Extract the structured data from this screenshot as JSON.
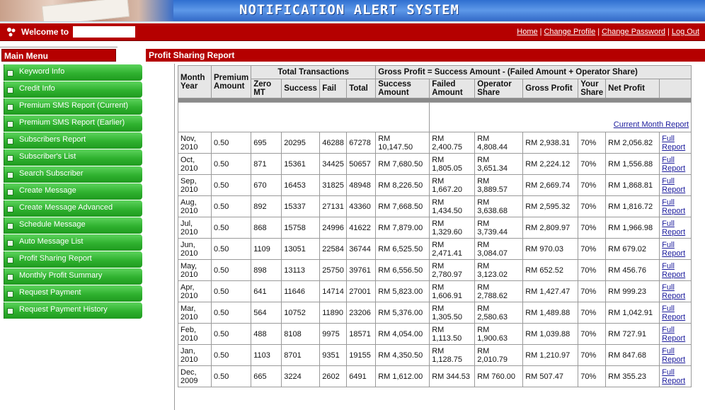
{
  "banner": {
    "title": "NOTIFICATION ALERT SYSTEM"
  },
  "welcome": {
    "text": "Welcome to"
  },
  "top_links": [
    "Home",
    "Change Profile",
    "Change Password",
    "Log Out"
  ],
  "menu": {
    "title": "Main Menu",
    "items": [
      "Keyword Info",
      "Credit Info",
      "Premium SMS Report (Current)",
      "Premium SMS Report (Earlier)",
      "Subscribers Report",
      "Subscriber's List",
      "Search Subscriber",
      "Create Message",
      "Create Message Advanced",
      "Schedule Message",
      "Auto Message List",
      "Profit Sharing Report",
      "Monthly Profit Summary",
      "Request Payment",
      "Request Payment History"
    ]
  },
  "report": {
    "title": "Profit Sharing Report",
    "headers": {
      "month_year": "Month Year",
      "premium_amount": "Premium Amount",
      "total_transactions": "Total Transactions",
      "gross_formula": "Gross Profit = Success Amount - (Failed Amount + Operator Share)",
      "zero_mt": "Zero MT",
      "success": "Success",
      "fail": "Fail",
      "total": "Total",
      "success_amount": "Success Amount",
      "failed_amount": "Failed Amount",
      "operator_share": "Operator Share",
      "gross_profit": "Gross Profit",
      "your_share": "Your Share",
      "net_profit": "Net Profit"
    },
    "current_month_link": "Current Month Report",
    "full_report_label": "Full Report",
    "rows": [
      {
        "month": "Nov, 2010",
        "premium": "0.50",
        "zero_mt": "695",
        "success": "20295",
        "fail": "46288",
        "total": "67278",
        "success_amount": "RM 10,147.50",
        "failed_amount": "RM 2,400.75",
        "operator_share": "RM 4,808.44",
        "gross_profit": "RM 2,938.31",
        "your_share": "70%",
        "net_profit": "RM 2,056.82"
      },
      {
        "month": "Oct, 2010",
        "premium": "0.50",
        "zero_mt": "871",
        "success": "15361",
        "fail": "34425",
        "total": "50657",
        "success_amount": "RM 7,680.50",
        "failed_amount": "RM 1,805.05",
        "operator_share": "RM 3,651.34",
        "gross_profit": "RM 2,224.12",
        "your_share": "70%",
        "net_profit": "RM 1,556.88"
      },
      {
        "month": "Sep, 2010",
        "premium": "0.50",
        "zero_mt": "670",
        "success": "16453",
        "fail": "31825",
        "total": "48948",
        "success_amount": "RM 8,226.50",
        "failed_amount": "RM 1,667.20",
        "operator_share": "RM 3,889.57",
        "gross_profit": "RM 2,669.74",
        "your_share": "70%",
        "net_profit": "RM 1,868.81"
      },
      {
        "month": "Aug, 2010",
        "premium": "0.50",
        "zero_mt": "892",
        "success": "15337",
        "fail": "27131",
        "total": "43360",
        "success_amount": "RM 7,668.50",
        "failed_amount": "RM 1,434.50",
        "operator_share": "RM 3,638.68",
        "gross_profit": "RM 2,595.32",
        "your_share": "70%",
        "net_profit": "RM 1,816.72"
      },
      {
        "month": "Jul, 2010",
        "premium": "0.50",
        "zero_mt": "868",
        "success": "15758",
        "fail": "24996",
        "total": "41622",
        "success_amount": "RM 7,879.00",
        "failed_amount": "RM 1,329.60",
        "operator_share": "RM 3,739.44",
        "gross_profit": "RM 2,809.97",
        "your_share": "70%",
        "net_profit": "RM 1,966.98"
      },
      {
        "month": "Jun, 2010",
        "premium": "0.50",
        "zero_mt": "1109",
        "success": "13051",
        "fail": "22584",
        "total": "36744",
        "success_amount": "RM 6,525.50",
        "failed_amount": "RM 2,471.41",
        "operator_share": "RM 3,084.07",
        "gross_profit": "RM 970.03",
        "your_share": "70%",
        "net_profit": "RM 679.02"
      },
      {
        "month": "May, 2010",
        "premium": "0.50",
        "zero_mt": "898",
        "success": "13113",
        "fail": "25750",
        "total": "39761",
        "success_amount": "RM 6,556.50",
        "failed_amount": "RM 2,780.97",
        "operator_share": "RM 3,123.02",
        "gross_profit": "RM 652.52",
        "your_share": "70%",
        "net_profit": "RM 456.76"
      },
      {
        "month": "Apr, 2010",
        "premium": "0.50",
        "zero_mt": "641",
        "success": "11646",
        "fail": "14714",
        "total": "27001",
        "success_amount": "RM 5,823.00",
        "failed_amount": "RM 1,606.91",
        "operator_share": "RM 2,788.62",
        "gross_profit": "RM 1,427.47",
        "your_share": "70%",
        "net_profit": "RM 999.23"
      },
      {
        "month": "Mar, 2010",
        "premium": "0.50",
        "zero_mt": "564",
        "success": "10752",
        "fail": "11890",
        "total": "23206",
        "success_amount": "RM 5,376.00",
        "failed_amount": "RM 1,305.50",
        "operator_share": "RM 2,580.63",
        "gross_profit": "RM 1,489.88",
        "your_share": "70%",
        "net_profit": "RM 1,042.91"
      },
      {
        "month": "Feb, 2010",
        "premium": "0.50",
        "zero_mt": "488",
        "success": "8108",
        "fail": "9975",
        "total": "18571",
        "success_amount": "RM 4,054.00",
        "failed_amount": "RM 1,113.50",
        "operator_share": "RM 1,900.63",
        "gross_profit": "RM 1,039.88",
        "your_share": "70%",
        "net_profit": "RM 727.91"
      },
      {
        "month": "Jan, 2010",
        "premium": "0.50",
        "zero_mt": "1103",
        "success": "8701",
        "fail": "9351",
        "total": "19155",
        "success_amount": "RM 4,350.50",
        "failed_amount": "RM 1,128.75",
        "operator_share": "RM 2,010.79",
        "gross_profit": "RM 1,210.97",
        "your_share": "70%",
        "net_profit": "RM 847.68"
      },
      {
        "month": "Dec, 2009",
        "premium": "0.50",
        "zero_mt": "665",
        "success": "3224",
        "fail": "2602",
        "total": "6491",
        "success_amount": "RM 1,612.00",
        "failed_amount": "RM 344.53",
        "operator_share": "RM 760.00",
        "gross_profit": "RM 507.47",
        "your_share": "70%",
        "net_profit": "RM 355.23"
      }
    ]
  }
}
